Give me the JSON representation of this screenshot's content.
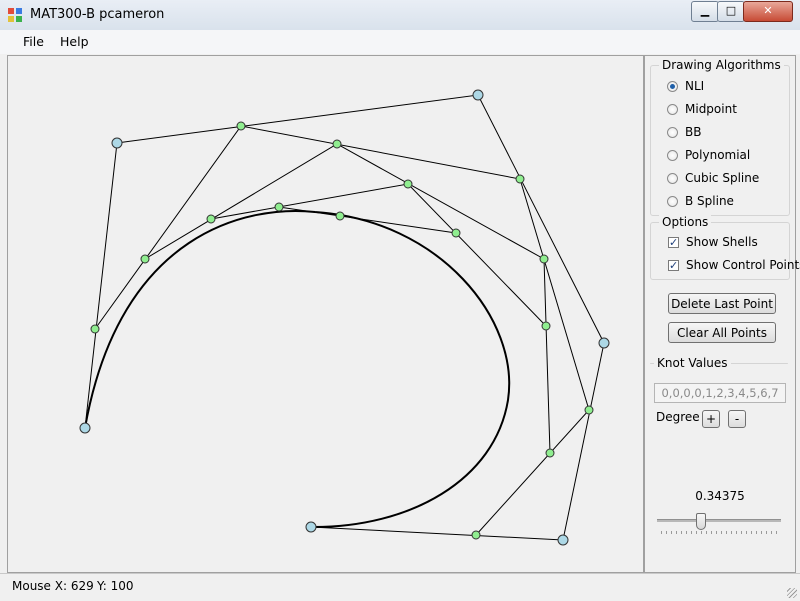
{
  "window": {
    "title": "MAT300-B  pcameron",
    "minimize_icon": "minimize-icon",
    "maximize_icon": "maximize-icon",
    "close_icon": "close-icon"
  },
  "menu": {
    "items": [
      "File",
      "Help"
    ]
  },
  "panel": {
    "drawing_algorithms": {
      "title": "Drawing Algorithms",
      "options": [
        "NLI",
        "Midpoint",
        "BB",
        "Polynomial",
        "Cubic Spline",
        "B Spline"
      ],
      "selected": "NLI"
    },
    "options": {
      "title": "Options",
      "show_shells": {
        "label": "Show Shells",
        "checked": true
      },
      "show_control_points": {
        "label": "Show Control Points",
        "checked": true
      }
    },
    "delete_last_point_label": "Delete Last Point",
    "clear_all_points_label": "Clear All Points",
    "knot_values": {
      "title": "Knot Values",
      "value": "0,0,0,0,1,2,3,4,5,6,7"
    },
    "degree": {
      "label": "Degree",
      "plus": "+",
      "minus": "-"
    },
    "t_value": "0.34375",
    "slider_fraction": 0.34375
  },
  "status": {
    "mouse_x": "Mouse X: 629",
    "mouse_y": "Y: 100"
  },
  "colors": {
    "control_point": "#add8e6",
    "shell_point": "#90ee90",
    "line": "#000000"
  }
}
